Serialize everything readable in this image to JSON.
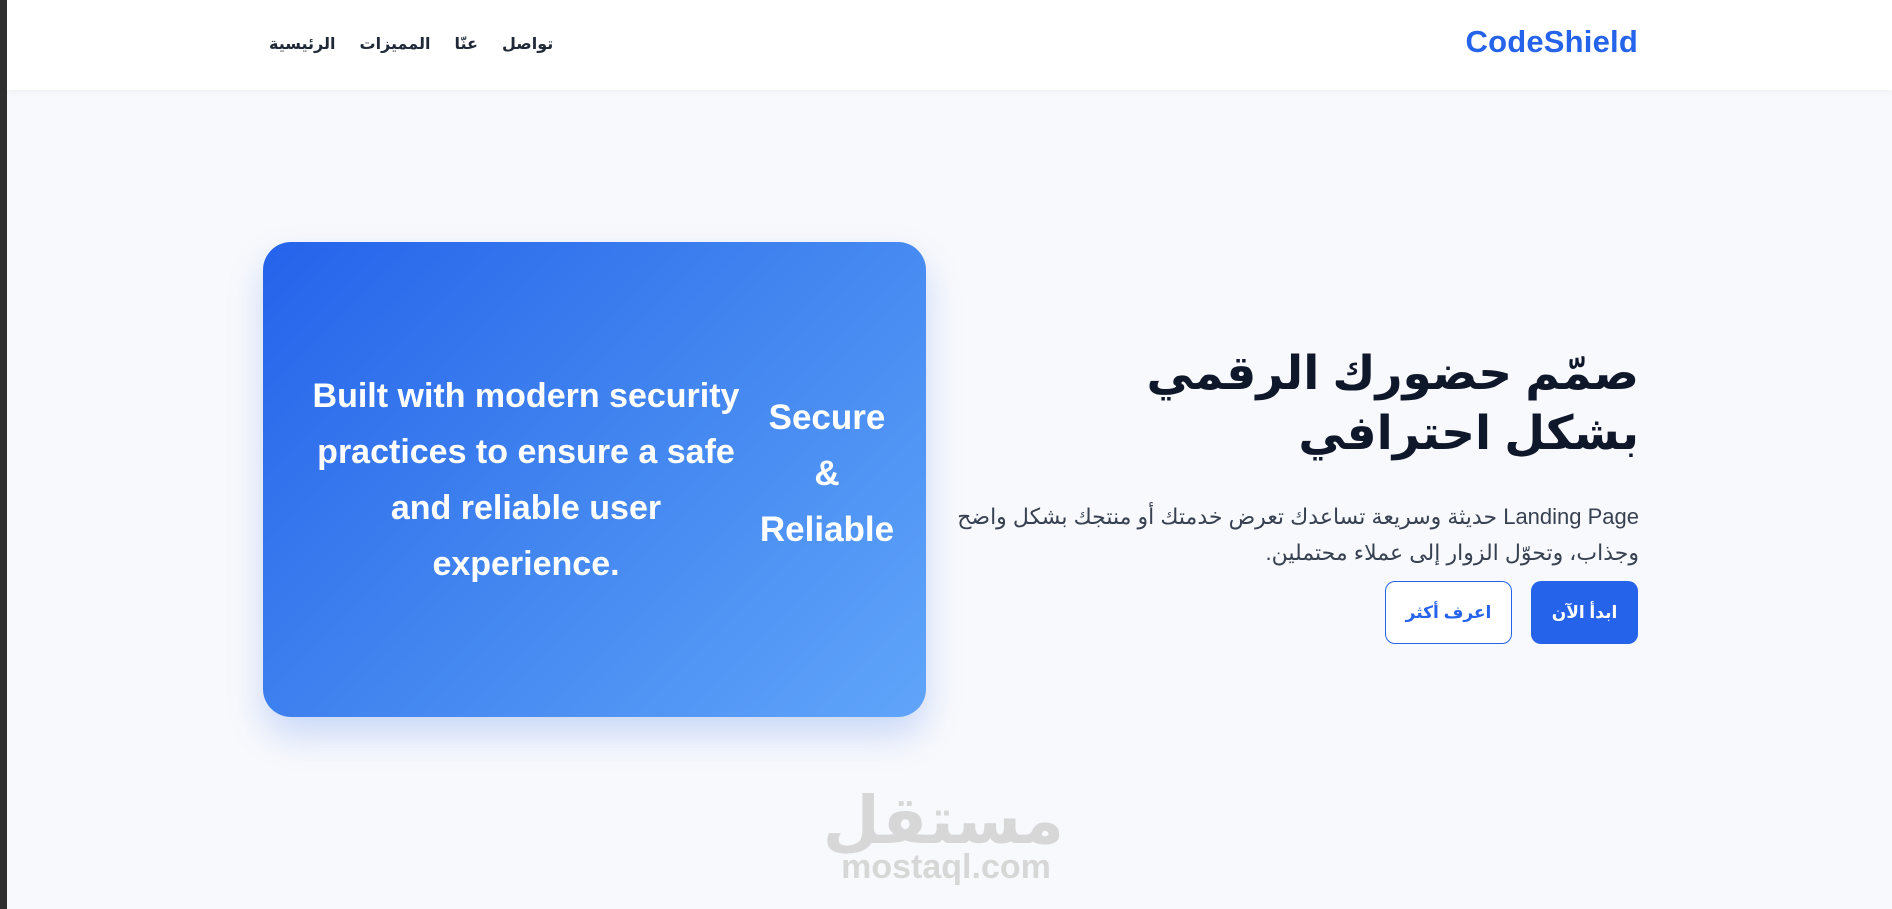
{
  "brand": "CodeShield",
  "nav": {
    "links": [
      "الرئيسية",
      "المميزات",
      "عنّا",
      "تواصل"
    ]
  },
  "hero": {
    "title": "صمّم حضورك الرقمي بشكل احترافي",
    "description_latin": "Landing Page",
    "description_ar": " حديثة وسريعة تساعدك تعرض خدمتك أو منتجك بشكل واضح وجذاب، وتحوّل الزوار إلى عملاء محتملين.",
    "primary_button": "ابدأ الآن",
    "secondary_button": "اعرف أكثر"
  },
  "card": {
    "main_text": "Built with modern security practices to ensure a safe and reliable user experience.",
    "side_line1": "Secure",
    "side_line2": "&",
    "side_line3": "Reliable"
  },
  "watermark": {
    "ar": "مستقل",
    "en": "mostaql.com"
  },
  "colors": {
    "accent": "#2563eb",
    "text_dark": "#0f172a",
    "background": "#f8f9fc"
  }
}
